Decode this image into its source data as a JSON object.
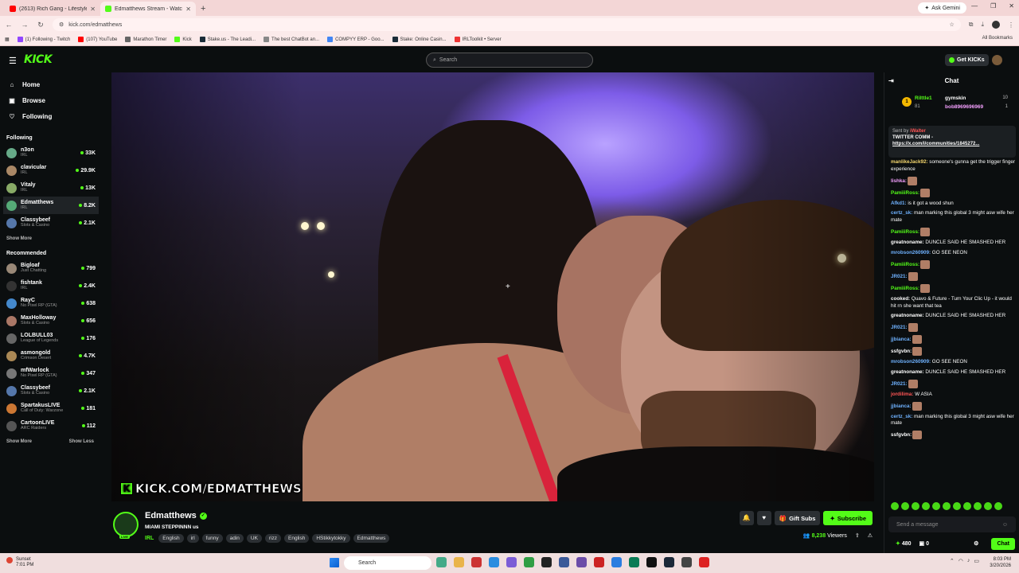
{
  "browser": {
    "tabs": [
      {
        "title": "(2613) Rich Gang - Lifestyle (Offi",
        "color": "#ff0000"
      },
      {
        "title": "Edmatthews Stream - Watch Live",
        "color": "#53fc18"
      }
    ],
    "new_tab": "+",
    "gemini": "Ask Gemini",
    "url": "kick.com/edmatthews",
    "bookmarks": [
      {
        "label": "(1) Following - Twitch",
        "color": "#9146ff"
      },
      {
        "label": "(107) YouTube",
        "color": "#ff0000"
      },
      {
        "label": "Marathon Timer",
        "color": "#666"
      },
      {
        "label": "Kick",
        "color": "#53fc18"
      },
      {
        "label": "Stake.us - The Leadi...",
        "color": "#1a2c38"
      },
      {
        "label": "The best ChatBot an...",
        "color": "#888"
      },
      {
        "label": "COMPYY ERP - Goo...",
        "color": "#4285f4"
      },
      {
        "label": "Stake: Online Casin...",
        "color": "#1a2c38"
      },
      {
        "label": "IRLToolkit • Server",
        "color": "#e33"
      }
    ],
    "all_bookmarks": "All Bookmarks"
  },
  "header": {
    "logo": "KICK",
    "search_placeholder": "Search",
    "get_kicks": "Get KICKs"
  },
  "sidebar": {
    "nav": [
      {
        "icon": "⌂",
        "label": "Home"
      },
      {
        "icon": "▣",
        "label": "Browse"
      },
      {
        "icon": "♡",
        "label": "Following"
      }
    ],
    "following_title": "Following",
    "following": [
      {
        "name": "n3on",
        "cat": "IRL",
        "viewers": "33K",
        "color": "#6a8"
      },
      {
        "name": "clavicular",
        "cat": "IRL",
        "viewers": "29.9K",
        "color": "#a86"
      },
      {
        "name": "Vitaly",
        "cat": "IRL",
        "viewers": "13K",
        "color": "#8a6"
      },
      {
        "name": "Edmatthews",
        "cat": "IRL",
        "viewers": "8.2K",
        "color": "#5a7"
      },
      {
        "name": "Classybeef",
        "cat": "Slots & Casino",
        "viewers": "2.1K",
        "color": "#57a"
      }
    ],
    "show_more": "Show More",
    "recommended_title": "Recommended",
    "recommended": [
      {
        "name": "Bigloaf",
        "cat": "Just Chatting",
        "viewers": "799",
        "color": "#987"
      },
      {
        "name": "fishtank",
        "cat": "IRL",
        "viewers": "2.4K",
        "color": "#333"
      },
      {
        "name": "RayC",
        "cat": "No Pixel RP (GTA)",
        "viewers": "638",
        "color": "#48c"
      },
      {
        "name": "MaxHolloway",
        "cat": "Slots & Casino",
        "viewers": "656",
        "color": "#a76"
      },
      {
        "name": "LOLBULL03",
        "cat": "League of Legends",
        "viewers": "176",
        "color": "#666"
      },
      {
        "name": "asmongold",
        "cat": "Crimson Desert",
        "viewers": "4.7K",
        "color": "#a85"
      },
      {
        "name": "mfWarlock",
        "cat": "No Pixel RP (GTA)",
        "viewers": "347",
        "color": "#777"
      },
      {
        "name": "Classybeef",
        "cat": "Slots & Casino",
        "viewers": "2.1K",
        "color": "#57a"
      },
      {
        "name": "SpartakusLIVE",
        "cat": "Call of Duty: Warzone",
        "viewers": "181",
        "color": "#c73"
      },
      {
        "name": "CartoonLIVE",
        "cat": "ARC Raiders",
        "viewers": "112",
        "color": "#555"
      }
    ],
    "show_more2": "Show More",
    "show_less": "Show Less"
  },
  "video": {
    "watermark": "KICK.COM/EDMATTHEWS",
    "watermark_k": "K"
  },
  "stream": {
    "name": "Edmatthews",
    "title": "MIAMI STEPPINNN us",
    "live": "LIVE",
    "category": "IRL",
    "tags": [
      "English",
      "irl",
      "funny",
      "adin",
      "UK",
      "rizz",
      "English",
      "HStikkytokky",
      "Edmatthews"
    ],
    "gift_subs": "Gift Subs",
    "subscribe": "Subscribe",
    "viewers": "8,238",
    "viewers_label": "Viewers"
  },
  "chat": {
    "title": "Chat",
    "leader1_name": "Rilttle1",
    "leader1_sub": "81",
    "leader2_name": "gymskin",
    "leader2_num": "10",
    "leader3_name": "bob8969696969",
    "leader3_num": "1",
    "pinned_label": "Sent by",
    "pinned_user": "iWalter",
    "pinned_title": "TWITTER COMM -",
    "pinned_link": "https://x.com/i/communities/1845272...",
    "messages": [
      {
        "user": "manlikeJack92:",
        "text": " someone's gunna get the trigger finger experience",
        "color": "#f5d76e"
      },
      {
        "user": "lishka:",
        "text": "",
        "color": "#f5a0ff"
      },
      {
        "user": "PamiiiRoss:",
        "text": "",
        "color": "#53fc18"
      },
      {
        "user": "Afkd1:",
        "text": " is it got a wood shun",
        "color": "#6fb2ff"
      },
      {
        "user": "certz_sk:",
        "text": " man marking this global 3 might asw wife her mate",
        "color": "#6fb2ff"
      },
      {
        "user": "PamiiiRoss:",
        "text": "",
        "color": "#53fc18"
      },
      {
        "user": "greatnoname:",
        "text": " DUNCLE SAID HE SMASHED HER",
        "color": "#fff"
      },
      {
        "user": "mrobson260909:",
        "text": " GO SEE NEON",
        "color": "#6fb2ff"
      },
      {
        "user": "PamiiiRoss:",
        "text": "",
        "color": "#53fc18"
      },
      {
        "user": "JR021:",
        "text": "",
        "color": "#6fb2ff"
      },
      {
        "user": "PamiiiRoss:",
        "text": "",
        "color": "#53fc18"
      },
      {
        "user": "cooked:",
        "text": " Quavo & Future - Turn Your Clic Up - it would hit rn she want that tea",
        "color": "#fff"
      },
      {
        "user": "greatnoname:",
        "text": " DUNCLE SAID HE SMASHED HER",
        "color": "#fff"
      },
      {
        "user": "JR021:",
        "text": "",
        "color": "#6fb2ff"
      },
      {
        "user": "jjbianca:",
        "text": "",
        "color": "#6fb2ff"
      },
      {
        "user": "ssfgvbn:",
        "text": "",
        "color": "#fff"
      },
      {
        "user": "mrobson260909:",
        "text": " GO SEE NEON",
        "color": "#6fb2ff"
      },
      {
        "user": "greatnoname:",
        "text": " DUNCLE SAID HE SMASHED HER",
        "color": "#fff"
      },
      {
        "user": "JR021:",
        "text": "",
        "color": "#6fb2ff"
      },
      {
        "user": "jordilima:",
        "text": " W ASIA",
        "color": "#f55"
      },
      {
        "user": "jjbianca:",
        "text": "",
        "color": "#6fb2ff"
      },
      {
        "user": "certz_sk:",
        "text": " man marking this global 3 might asw wife her mate",
        "color": "#6fb2ff"
      },
      {
        "user": "ssfgvbn:",
        "text": "",
        "color": "#fff"
      }
    ],
    "send_placeholder": "Send a message",
    "points": "480",
    "gifts": "0",
    "chat_button": "Chat"
  },
  "taskbar": {
    "weather": "Sunset",
    "weather_time": "7:01 PM",
    "search": "Search",
    "time": "8:03 PM",
    "date": "3/20/2026"
  }
}
